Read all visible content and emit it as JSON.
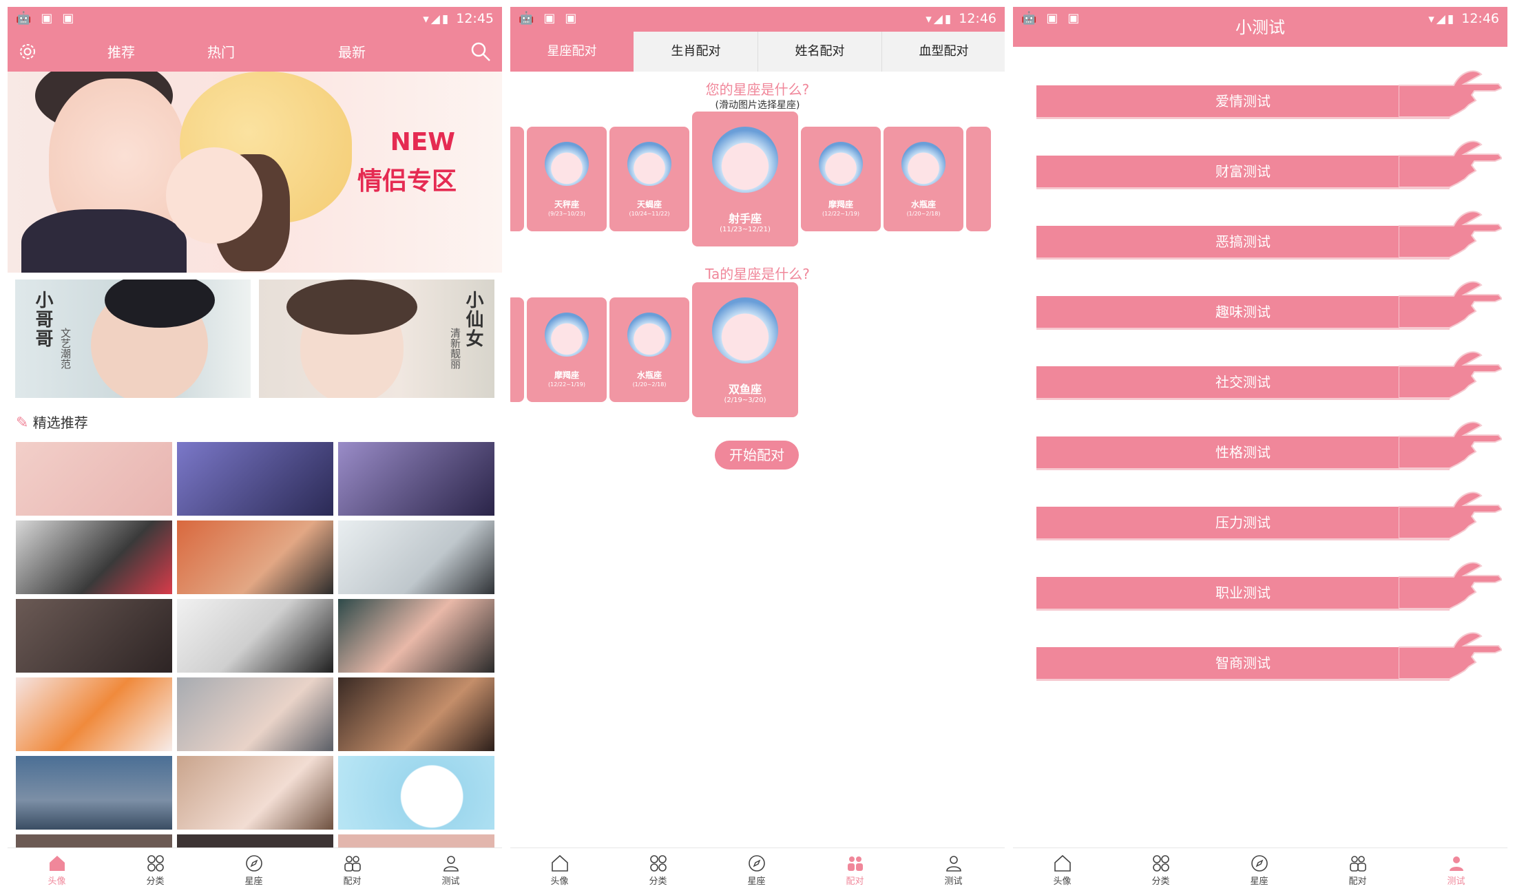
{
  "colors": {
    "accent": "#f0879a",
    "banner_red": "#e52b52"
  },
  "status": {
    "time1": "12:45",
    "time2": "12:46",
    "time3": "12:46"
  },
  "screen1": {
    "nav": [
      "推荐",
      "热门",
      "最新"
    ],
    "banner": {
      "new": "NEW",
      "title": "情侣专区"
    },
    "promo_left": {
      "title": "小哥哥",
      "subtitle": "文艺潮范"
    },
    "promo_right": {
      "title": "小仙女",
      "subtitle": "清新靓丽"
    },
    "section_title": "精选推荐"
  },
  "screen2": {
    "tabs": [
      "星座配对",
      "生肖配对",
      "姓名配对",
      "血型配对"
    ],
    "q1": "您的星座是什么?",
    "q1_hint": "(滑动图片选择星座)",
    "q2": "Ta的星座是什么?",
    "row1": [
      {
        "name": "天秤座",
        "date": "(9/23~10/23)"
      },
      {
        "name": "天蝎座",
        "date": "(10/24~11/22)"
      },
      {
        "name": "射手座",
        "date": "(11/23~12/21)"
      },
      {
        "name": "摩羯座",
        "date": "(12/22~1/19)"
      },
      {
        "name": "水瓶座",
        "date": "(1/20~2/18)"
      }
    ],
    "row2": [
      {
        "name": "摩羯座",
        "date": "(12/22~1/19)"
      },
      {
        "name": "水瓶座",
        "date": "(1/20~2/18)"
      },
      {
        "name": "双鱼座",
        "date": "(2/19~3/20)"
      }
    ],
    "start_button": "开始配对"
  },
  "screen3": {
    "title": "小测试",
    "items": [
      "爱情测试",
      "财富测试",
      "恶搞测试",
      "趣味测试",
      "社交测试",
      "性格测试",
      "压力测试",
      "职业测试",
      "智商测试"
    ]
  },
  "tabbar": [
    "头像",
    "分类",
    "星座",
    "配对",
    "测试"
  ]
}
